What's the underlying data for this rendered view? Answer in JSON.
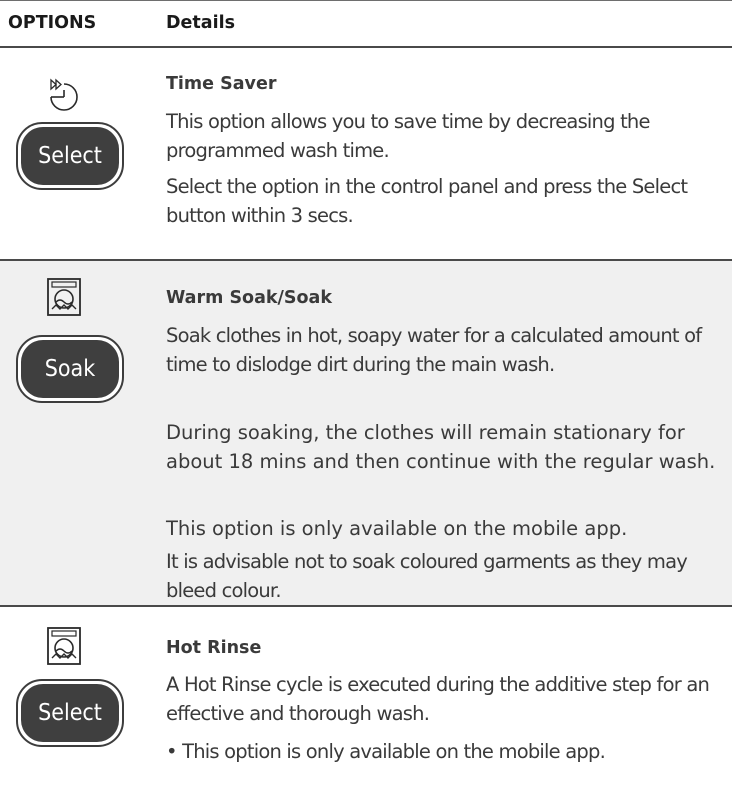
{
  "header": {
    "options": "OPTIONS",
    "details": "Details"
  },
  "rows": [
    {
      "icon": "time-saver-icon",
      "button": "Select",
      "title": "Time Saver",
      "paragraphs": [
        "This option allows you to save time by decreasing the programmed wash time.",
        "Select the option in the control panel and press the Select button within 3 secs."
      ]
    },
    {
      "icon": "soak-icon",
      "button": "Soak",
      "title": "Warm Soak/Soak",
      "paragraphs": [
        "Soak clothes in hot, soapy water for a calculated amount of time to dislodge dirt during the main wash.",
        "During soaking, the clothes will remain stationary for about 18 mins and then continue with the regular wash.",
        "This option is only available on the mobile app.",
        "It is advisable not to soak coloured garments as they may bleed colour."
      ]
    },
    {
      "icon": "hot-rinse-icon",
      "button": "Select",
      "title": "Hot Rinse",
      "paragraphs": [
        "A Hot Rinse cycle is executed during the additive step for an effective and thorough wash.",
        "• This option is only available on the mobile app."
      ]
    }
  ]
}
